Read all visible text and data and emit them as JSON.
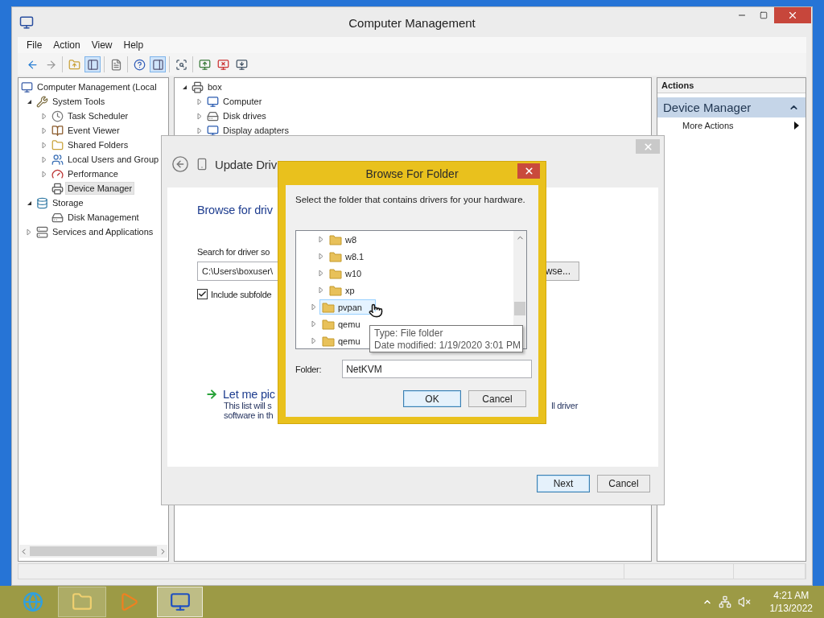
{
  "window": {
    "title": "Computer Management"
  },
  "menu": [
    "File",
    "Action",
    "View",
    "Help"
  ],
  "toolbar": {
    "groups": [
      [
        {
          "disabled": false,
          "pressed": false
        },
        {
          "disabled": true,
          "pressed": false
        }
      ],
      [
        {
          "disabled": false,
          "pressed": false
        },
        {
          "disabled": false,
          "pressed": true
        }
      ],
      [
        {
          "disabled": false,
          "pressed": false
        }
      ],
      [
        {
          "disabled": false,
          "pressed": false
        },
        {
          "disabled": false,
          "pressed": true
        }
      ],
      [
        {
          "disabled": false,
          "pressed": false
        }
      ],
      [
        {
          "disabled": false,
          "pressed": false
        },
        {
          "disabled": false,
          "pressed": false
        },
        {
          "disabled": false,
          "pressed": false
        }
      ]
    ]
  },
  "console_tree": [
    {
      "label": "Computer Management (Local",
      "selected": false,
      "children": [
        {
          "label": "System Tools",
          "expanded": true,
          "selected": false,
          "children": [
            {
              "label": "Task Scheduler",
              "expanded": false,
              "selected": false
            },
            {
              "label": "Event Viewer",
              "expanded": false,
              "selected": false
            },
            {
              "label": "Shared Folders",
              "expanded": false,
              "selected": false
            },
            {
              "label": "Local Users and Group",
              "expanded": false,
              "selected": false
            },
            {
              "label": "Performance",
              "expanded": false,
              "selected": false
            },
            {
              "label": "Device Manager",
              "selected": true
            }
          ]
        },
        {
          "label": "Storage",
          "expanded": true,
          "selected": false,
          "children": [
            {
              "label": "Disk Management",
              "selected": false
            }
          ]
        },
        {
          "label": "Services and Applications",
          "expanded": false,
          "selected": false
        }
      ]
    }
  ],
  "device_tree": [
    {
      "label": "box",
      "expanded": true,
      "selected": false,
      "children": [
        {
          "label": "Computer",
          "expanded": false,
          "selected": false
        },
        {
          "label": "Disk drives",
          "expanded": false,
          "selected": false
        },
        {
          "label": "Display adapters",
          "expanded": false,
          "selected": false
        }
      ]
    }
  ],
  "actions": {
    "header": "Actions",
    "section": {
      "label": "Device Manager",
      "expanded": true
    },
    "items": [
      {
        "label": "More Actions"
      }
    ]
  },
  "update_driver": {
    "title": "Update Driv",
    "heading": "Browse for driv",
    "search_label": "Search for driver so",
    "path": "C:\\Users\\boxuser\\",
    "browse_button": "wse...",
    "include_subfolders": {
      "label": "Include subfolde",
      "checked": true
    },
    "pick": {
      "title": "Let me pic",
      "line_1": "This list will s",
      "line_1_end": "ll driver",
      "line_2": "software in th"
    },
    "buttons": [
      {
        "label": "Next",
        "default": true
      },
      {
        "label": "Cancel",
        "default": false
      }
    ]
  },
  "browse_dialog": {
    "title": "Browse For Folder",
    "instruction": "Select the folder that contains drivers for your hardware.",
    "tree": [
      {
        "children": [
          {
            "label": "w8",
            "expanded": false,
            "selected": false
          },
          {
            "label": "w8.1",
            "expanded": false,
            "selected": false
          },
          {
            "label": "w10",
            "expanded": false,
            "selected": false
          },
          {
            "label": "xp",
            "expanded": false,
            "selected": false
          }
        ]
      },
      {
        "label": "pvpan",
        "expanded": false,
        "selected": true
      },
      {
        "label": "qemu",
        "expanded": false,
        "selected": false
      },
      {
        "label": "qemu",
        "expanded": false,
        "selected": false
      }
    ],
    "tooltip": [
      "Type: File folder",
      "Date modified: 1/19/2020 3:01 PM"
    ],
    "folder_label": "Folder:",
    "folder_value": "NetKVM",
    "buttons": [
      {
        "label": "OK",
        "default": true
      },
      {
        "label": "Cancel",
        "default": false
      }
    ]
  },
  "taskbar": {
    "apps": [
      {
        "running": false,
        "active": false
      },
      {
        "running": true,
        "active": false
      },
      {
        "running": false,
        "active": false
      },
      {
        "running": true,
        "active": true
      }
    ],
    "clock": {
      "time": "4:21 AM",
      "date": "1/13/2022"
    }
  }
}
